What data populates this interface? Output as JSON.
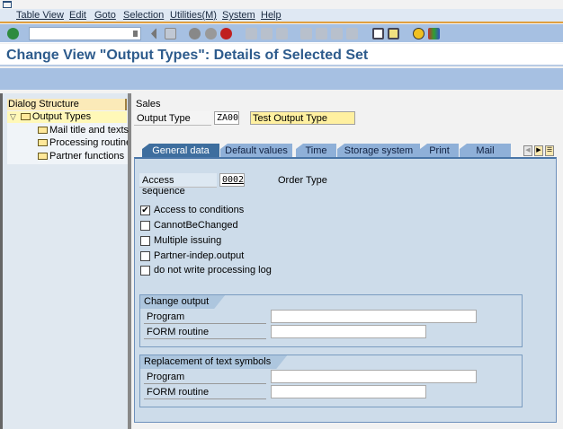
{
  "menu": [
    "Table View",
    "Edit",
    "Goto",
    "Selection",
    "Utilities(M)",
    "System",
    "Help"
  ],
  "toolbar": {
    "command_value": "",
    "icons": [
      "enter-icon",
      "back-icon",
      "save-icon",
      "back-nav-icon",
      "exit-icon",
      "cancel-icon",
      "print-icon",
      "find-icon",
      "find-next-icon",
      "first-page-icon",
      "prev-page-icon",
      "next-page-icon",
      "last-page-icon",
      "create-session-icon",
      "shortcut-icon",
      "help-icon",
      "customize-layout-icon"
    ],
    "colors": {
      "enter": "#2e8b3e",
      "cancel": "#c02020",
      "help": "#f0c020"
    }
  },
  "title": "Change View \"Output Types\": Details of Selected Set",
  "dialog": {
    "header": "Dialog Structure",
    "items": [
      {
        "label": "Output Types",
        "selected": true
      },
      {
        "label": "Mail title and texts"
      },
      {
        "label": "Processing routines"
      },
      {
        "label": "Partner functions"
      }
    ]
  },
  "header": {
    "section": "Sales",
    "output_type_label": "Output Type",
    "output_type_value": "ZA00",
    "output_type_desc": "Test Output Type"
  },
  "tabs": [
    "General data",
    "Default values",
    "Time",
    "Storage system",
    "Print",
    "Mail"
  ],
  "general": {
    "access_sequence_label": "Access sequence",
    "access_sequence_value": "0002",
    "access_sequence_desc": "Order Type",
    "checkboxes": [
      {
        "label": "Access to conditions",
        "checked": true
      },
      {
        "label": "CannotBeChanged",
        "checked": false
      },
      {
        "label": "Multiple issuing",
        "checked": false
      },
      {
        "label": "Partner-indep.output",
        "checked": false
      },
      {
        "label": "do not write processing log",
        "checked": false
      }
    ],
    "change_output": {
      "title": "Change output",
      "program_label": "Program",
      "program_value": "",
      "form_label": "FORM routine",
      "form_value": ""
    },
    "replacement": {
      "title": "Replacement of text symbols",
      "program_label": "Program",
      "program_value": "",
      "form_label": "FORM routine",
      "form_value": ""
    }
  }
}
